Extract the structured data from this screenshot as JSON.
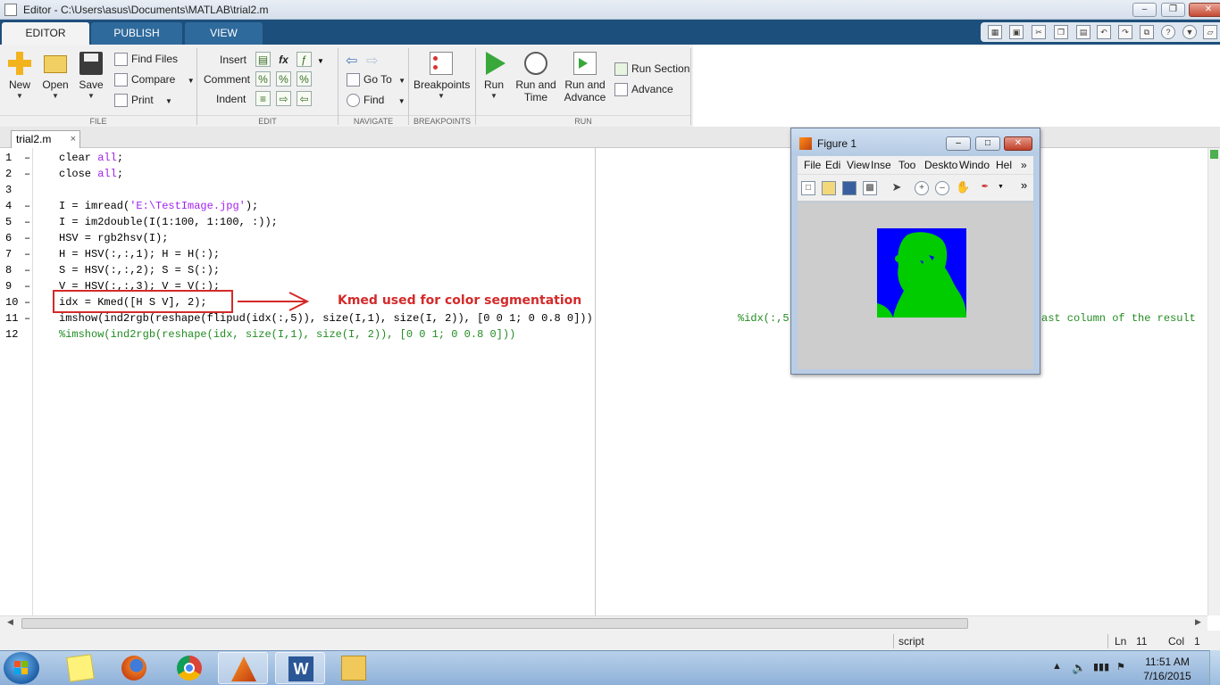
{
  "window": {
    "title": "Editor - C:\\Users\\asus\\Documents\\MATLAB\\trial2.m"
  },
  "ribbon": {
    "tabs": [
      {
        "label": "EDITOR"
      },
      {
        "label": "PUBLISH"
      },
      {
        "label": "VIEW"
      }
    ],
    "file": {
      "new": "New",
      "open": "Open",
      "save": "Save",
      "find_files": "Find Files",
      "compare": "Compare",
      "print": "Print",
      "section": "FILE"
    },
    "edit": {
      "insert": "Insert",
      "comment": "Comment",
      "indent": "Indent",
      "fx": "fx",
      "section": "EDIT"
    },
    "navigate": {
      "goto": "Go To",
      "find": "Find",
      "section": "NAVIGATE"
    },
    "breakpoints": {
      "label": "Breakpoints",
      "section": "BREAKPOINTS"
    },
    "run": {
      "run": "Run",
      "run_time_1": "Run and",
      "run_time_2": "Time",
      "run_adv_1": "Run and",
      "run_adv_2": "Advance",
      "run_section": "Run Section",
      "advance": "Advance",
      "section": "RUN"
    }
  },
  "doc_tab": {
    "label": "trial2.m",
    "close": "×"
  },
  "code": {
    "lines": [
      {
        "num": "1",
        "dash": "–"
      },
      {
        "num": "2",
        "dash": "–"
      },
      {
        "num": "3",
        "dash": ""
      },
      {
        "num": "4",
        "dash": "–"
      },
      {
        "num": "5",
        "dash": "–"
      },
      {
        "num": "6",
        "dash": "–"
      },
      {
        "num": "7",
        "dash": "–"
      },
      {
        "num": "8",
        "dash": "–"
      },
      {
        "num": "9",
        "dash": "–"
      },
      {
        "num": "10",
        "dash": "–"
      },
      {
        "num": "11",
        "dash": "–"
      },
      {
        "num": "12",
        "dash": ""
      }
    ],
    "l1a": "clear ",
    "l1b": "all",
    "l1c": ";",
    "l2a": "close ",
    "l2b": "all",
    "l2c": ";",
    "l4a": "I = imread(",
    "l4b": "'E:\\TestImage.jpg'",
    "l4c": ");",
    "l5": "I = im2double(I(1:100, 1:100, :));",
    "l6": "HSV = rgb2hsv(I);",
    "l7": "H = HSV(:,:,1); H = H(:);",
    "l8": "S = HSV(:,:,2); S = S(:);",
    "l9": "V = HSV(:,:,3); V = V(:);",
    "l10": "idx = Kmed([H S V], 2);",
    "l11": "imshow(ind2rgb(reshape(flipud(idx(:,5)), size(I,1), size(I, 2)), [0 0 1; 0 0.8 0]))",
    "l11c1": "%idx(:,5",
    "l11c2": "ast column of the result",
    "l12": "%imshow(ind2rgb(reshape(idx, size(I,1), size(I, 2)), [0 0 1; 0 0.8 0]))"
  },
  "annotation": {
    "text": "Kmed used for color segmentation"
  },
  "status": {
    "mode": "script",
    "ln_label": "Ln",
    "ln": "11",
    "col_label": "Col",
    "col": "1"
  },
  "figure": {
    "title": "Figure 1",
    "menu": [
      "File",
      "Edi",
      "View",
      "Inse",
      "Too",
      "Deskto",
      "Windo",
      "Hel"
    ],
    "more": "»"
  },
  "taskbar": {
    "time": "11:51 AM",
    "date": "7/16/2015"
  },
  "colors": {
    "ribbon_tab_bg": "#1d4f7c",
    "annotation": "#d42a2a",
    "keyword": "#a020f0",
    "comment": "#228b22",
    "seg_blue": "#0000ff",
    "seg_green": "#00cc00"
  }
}
